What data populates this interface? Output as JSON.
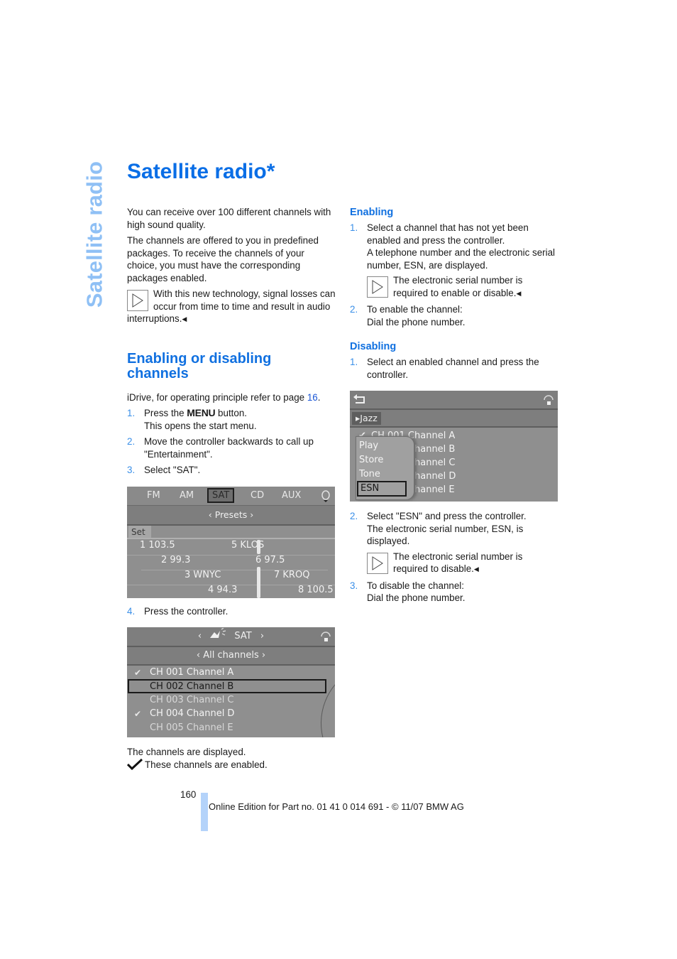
{
  "side_tab": "Satellite radio",
  "title": "Satellite radio*",
  "intro": {
    "p1": "You can receive over 100 different channels with high sound quality.",
    "p2": "The channels are offered to you in predefined packages. To receive the channels of your choice, you must have the corresponding packages enabled.",
    "note": "With this new technology, signal losses can occur from time to time and result in audio interruptions."
  },
  "section": {
    "heading": "Enabling or disabling channels",
    "idrive_text": "iDrive, for operating principle refer to page ",
    "idrive_page": "16",
    "steps": [
      {
        "num": "1.",
        "pre": "Press the ",
        "menu": "MENU",
        "post": " button.",
        "line2": "This opens the start menu."
      },
      {
        "num": "2.",
        "text": "Move the controller backwards to call up \"Entertainment\"."
      },
      {
        "num": "3.",
        "text": "Select \"SAT\"."
      },
      {
        "num": "4.",
        "text": "Press the controller."
      }
    ],
    "after_list": "The channels are displayed.",
    "legend": "These channels are enabled."
  },
  "screen_presets": {
    "tabs": [
      "FM",
      "AM",
      "SAT",
      "CD",
      "AUX"
    ],
    "active_tab": "SAT",
    "submenu": "Presets",
    "set_label": "Set",
    "presets": [
      {
        "label": "1 103.5"
      },
      {
        "label": "2 99.3"
      },
      {
        "label": "3 WNYC"
      },
      {
        "label": "4 94.3"
      },
      {
        "label": "5 KLOS"
      },
      {
        "label": "6 97.5"
      },
      {
        "label": "7 KROQ"
      },
      {
        "label": "8 100.5"
      }
    ]
  },
  "screen_channels": {
    "header": "SAT",
    "submenu": "All channels",
    "channels": [
      {
        "label": "CH 001 Channel A",
        "enabled": true,
        "selected": false
      },
      {
        "label": "CH 002 Channel B",
        "enabled": false,
        "selected": true
      },
      {
        "label": "CH 003 Channel C",
        "enabled": false,
        "selected": false
      },
      {
        "label": "CH 004 Channel D",
        "enabled": true,
        "selected": false
      },
      {
        "label": "CH 005 Channel E",
        "enabled": false,
        "selected": false
      }
    ]
  },
  "enabling": {
    "heading": "Enabling",
    "step1_num": "1.",
    "step1_a": "Select a channel that has not yet been enabled and press the controller.",
    "step1_b": "A telephone number and the electronic serial number, ESN, are displayed.",
    "note": "The electronic serial number is required to enable or disable.",
    "step2_num": "2.",
    "step2_a": "To enable the channel:",
    "step2_b": "Dial the phone number."
  },
  "disabling": {
    "heading": "Disabling",
    "step1_num": "1.",
    "step1": "Select an enabled channel and press the controller.",
    "step2_num": "2.",
    "step2_a": "Select \"ESN\" and press the controller.",
    "step2_b": "The electronic serial number, ESN, is displayed.",
    "note": "The electronic serial number is required to disable.",
    "step3_num": "3.",
    "step3_a": "To disable the channel:",
    "step3_b": "Dial the phone number."
  },
  "screen_menu": {
    "category": "Jazz",
    "channels": [
      "CH 001 Channel A",
      "hannel B",
      "hannel C",
      "hannel D",
      "hannel E"
    ],
    "popup": [
      "Play",
      "Store",
      "Tone",
      "ESN"
    ],
    "popup_selected": "ESN"
  },
  "footer": {
    "page_number": "160",
    "text": "Online Edition for Part no. 01 41 0 014 691 - © 11/07 BMW AG"
  },
  "colors": {
    "heading": "#0a6ee6",
    "side_tab": "#8fc0f5",
    "step_number": "#3a8fe8",
    "footer_bar": "#b4d3fa"
  }
}
